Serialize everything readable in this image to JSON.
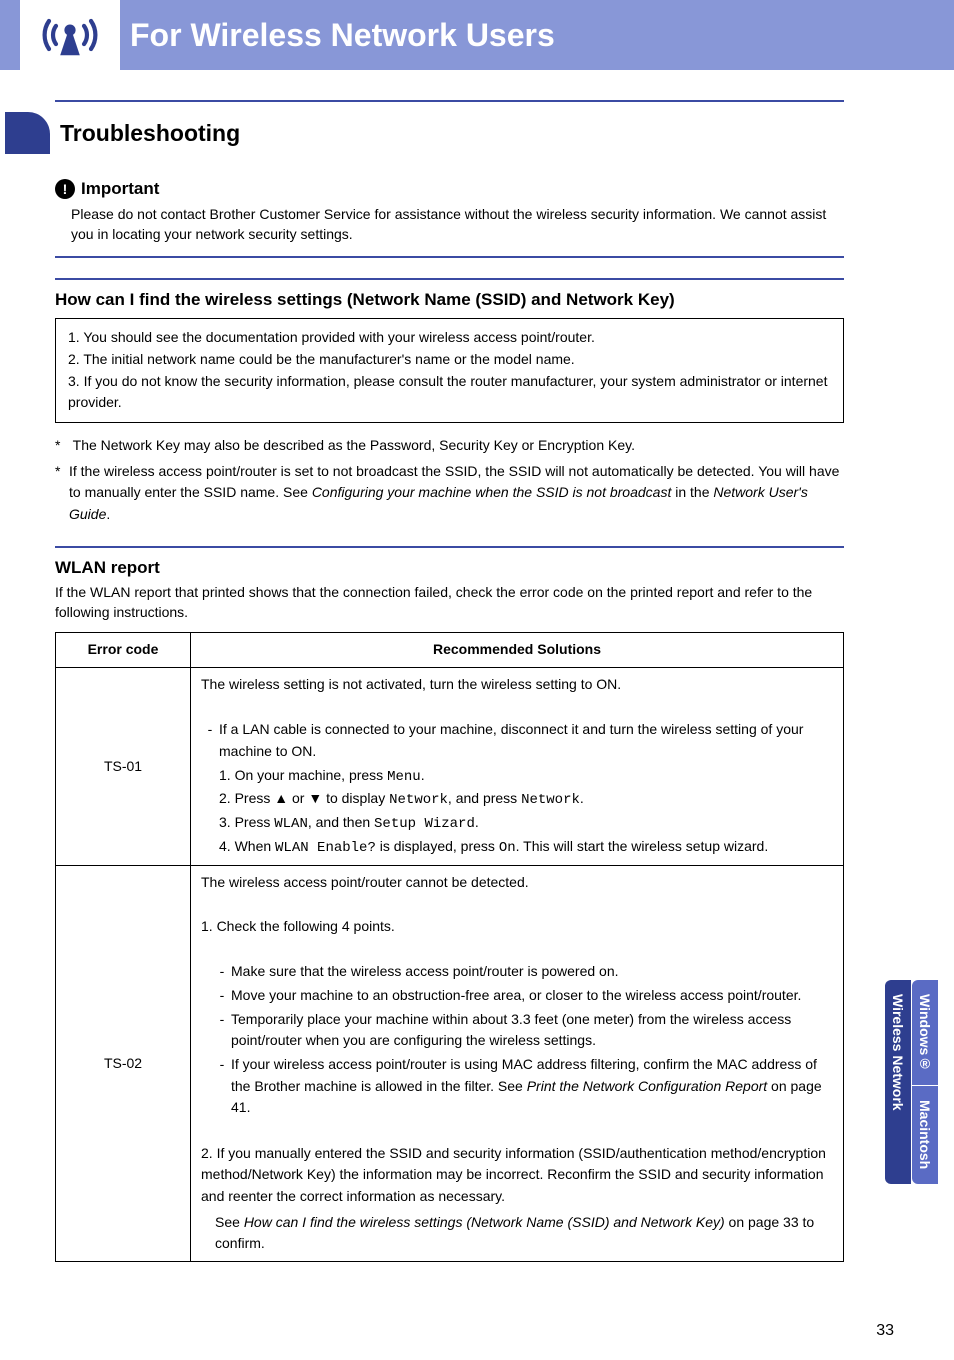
{
  "header": {
    "title": "For Wireless Network Users"
  },
  "section": {
    "heading": "Troubleshooting"
  },
  "important": {
    "label": "Important",
    "text": "Please do not contact Brother Customer Service for assistance without the wireless security information. We cannot assist you in locating your network security settings."
  },
  "find_settings": {
    "heading": "How can I find the wireless settings (Network Name (SSID) and Network Key)",
    "items": [
      "1. You should see the documentation provided with your wireless access point/router.",
      "2. The initial network name could be the manufacturer's name or the model name.",
      "3. If you do not know the security information, please consult the router manufacturer, your system administrator or internet provider."
    ],
    "notes": [
      {
        "ast": "*",
        "text": "The Network Key may also be described as the Password, Security Key or Encryption Key."
      },
      {
        "ast": "*",
        "text_pre": "If the wireless access point/router is set to not broadcast the SSID, the SSID will not automatically be detected. You will have to manually enter the SSID name. See ",
        "italic1": "Configuring your machine when the SSID is not broadcast",
        "mid": " in the ",
        "italic2": "Network User's Guide",
        "post": "."
      }
    ]
  },
  "wlan": {
    "heading": "WLAN report",
    "intro": "If the WLAN report that printed shows that the connection failed, check the error code on the printed report and refer to the following instructions.",
    "table": {
      "head": {
        "c1": "Error code",
        "c2": "Recommended Solutions"
      },
      "rows": [
        {
          "code": "TS-01",
          "top": "The wireless setting is not activated, turn the wireless setting to ON.",
          "dash1": "If a LAN cable is connected to your machine, disconnect it and turn the wireless setting of your machine to ON.",
          "s1a": "1. On your machine, press ",
          "s1b": "Menu",
          "s1c": ".",
          "s2a": "2. Press ▲ or ▼ to display ",
          "s2b": "Network",
          "s2c": ", and press ",
          "s2d": "Network",
          "s2e": ".",
          "s3a": "3. Press ",
          "s3b": "WLAN",
          "s3c": ", and then ",
          "s3d": "Setup Wizard",
          "s3e": ".",
          "s4a": "4. When ",
          "s4b": "WLAN Enable?",
          "s4c": " is displayed, press ",
          "s4d": "On",
          "s4e": ". This will start the wireless setup wizard."
        },
        {
          "code": "TS-02",
          "top": "The wireless access point/router cannot be detected.",
          "p1": "1. Check the following 4 points.",
          "b1": "Make sure that the wireless access point/router is powered on.",
          "b2": "Move your machine to an obstruction-free area, or closer to the wireless access point/router.",
          "b3": "Temporarily place your machine within about 3.3 feet (one meter) from the wireless access point/router when you are configuring the wireless settings.",
          "b4a": "If your wireless access point/router is using MAC address filtering, confirm the MAC address of the Brother machine is allowed in the filter. See ",
          "b4i": "Print the Network Configuration Report",
          "b4b": " on page 41.",
          "p2": "2. If you manually entered the SSID and security information (SSID/authentication method/encryption method/Network Key) the information may be incorrect. Reconfirm the SSID and security information and reenter the correct information as necessary.",
          "p3a": "See ",
          "p3i": "How can I find the wireless settings (Network Name (SSID) and Network Key)",
          "p3b": " on page 33 to confirm."
        }
      ]
    }
  },
  "tabs": {
    "wn": "Wireless Network",
    "win": "Windows®",
    "mac": "Macintosh"
  },
  "page": "33"
}
